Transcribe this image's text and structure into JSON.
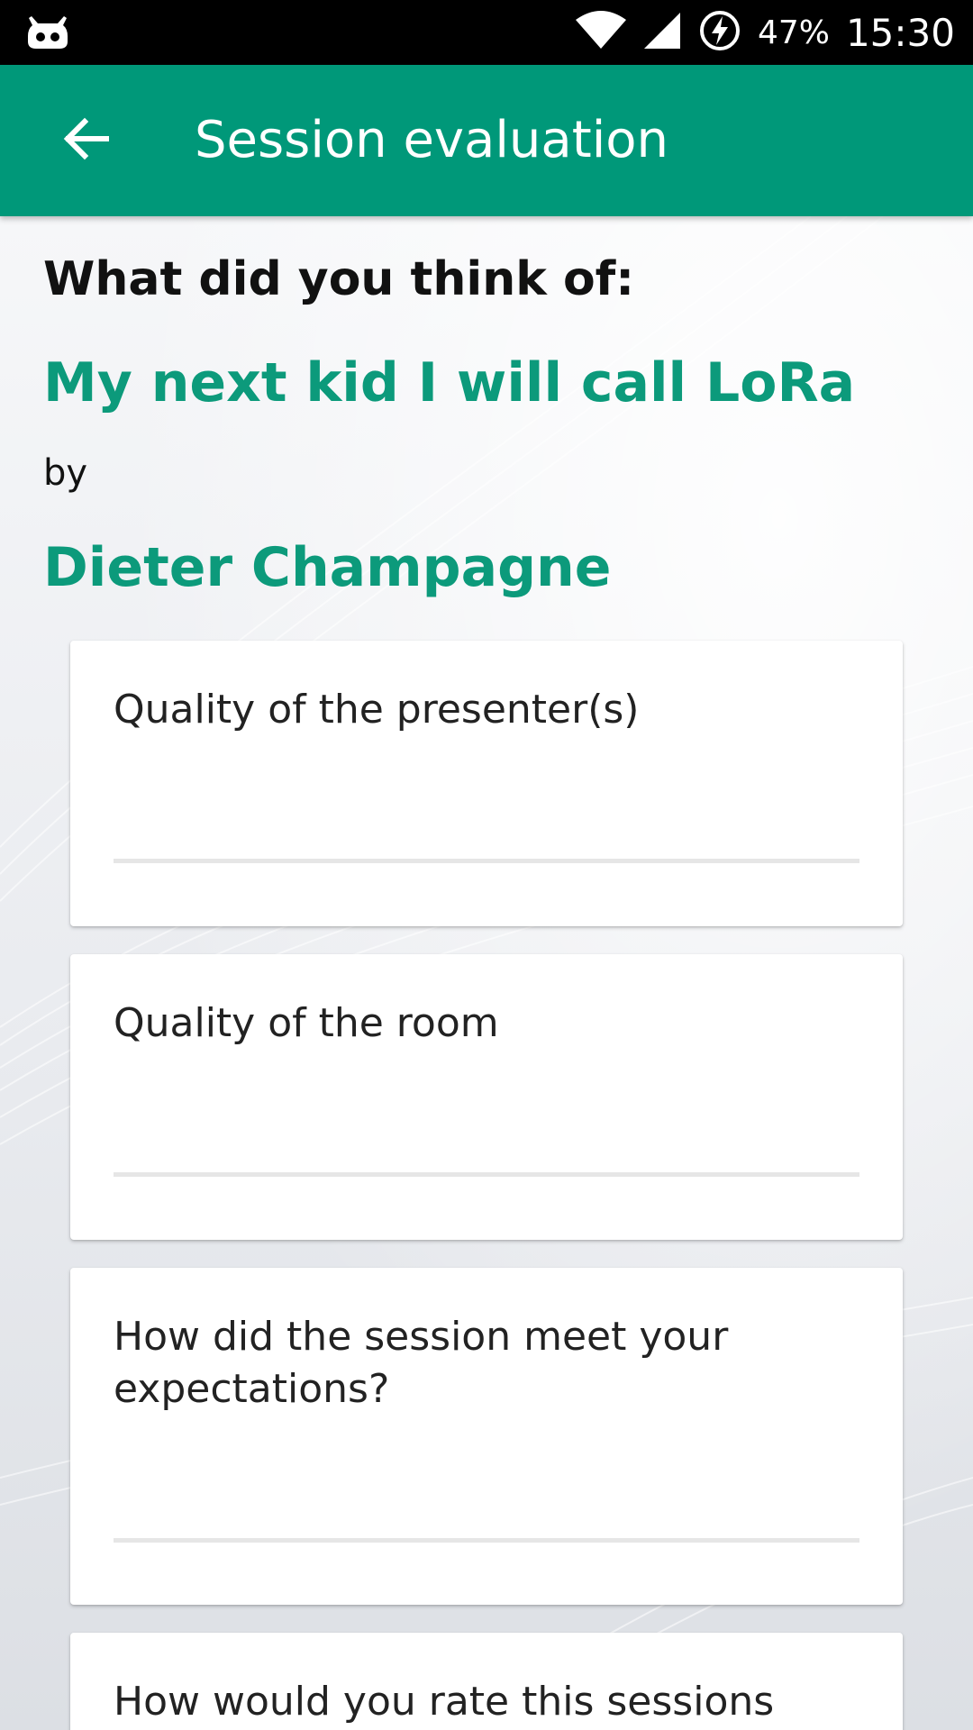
{
  "status_bar": {
    "left_icon": "cyanogen-mod-icon",
    "wifi_icon": "wifi-icon",
    "signal_icon": "cell-signal-icon",
    "battery_icon": "battery-charging-icon",
    "battery_percent": "47%",
    "time": "15:30"
  },
  "app_bar": {
    "back_icon": "arrow-back-icon",
    "title": "Session evaluation",
    "color": "#009879"
  },
  "evaluation": {
    "intro": "What did you think of:",
    "session_title": "My next kid I will call LoRa",
    "by_label": "by",
    "speaker": "Dieter Champagne",
    "accent_color": "#0c9a7b"
  },
  "questions": [
    {
      "label": "Quality of the presenter(s)"
    },
    {
      "label": "Quality of the room"
    },
    {
      "label": "How did the session meet your expectations?"
    },
    {
      "label": "How would you rate this sessions"
    }
  ]
}
